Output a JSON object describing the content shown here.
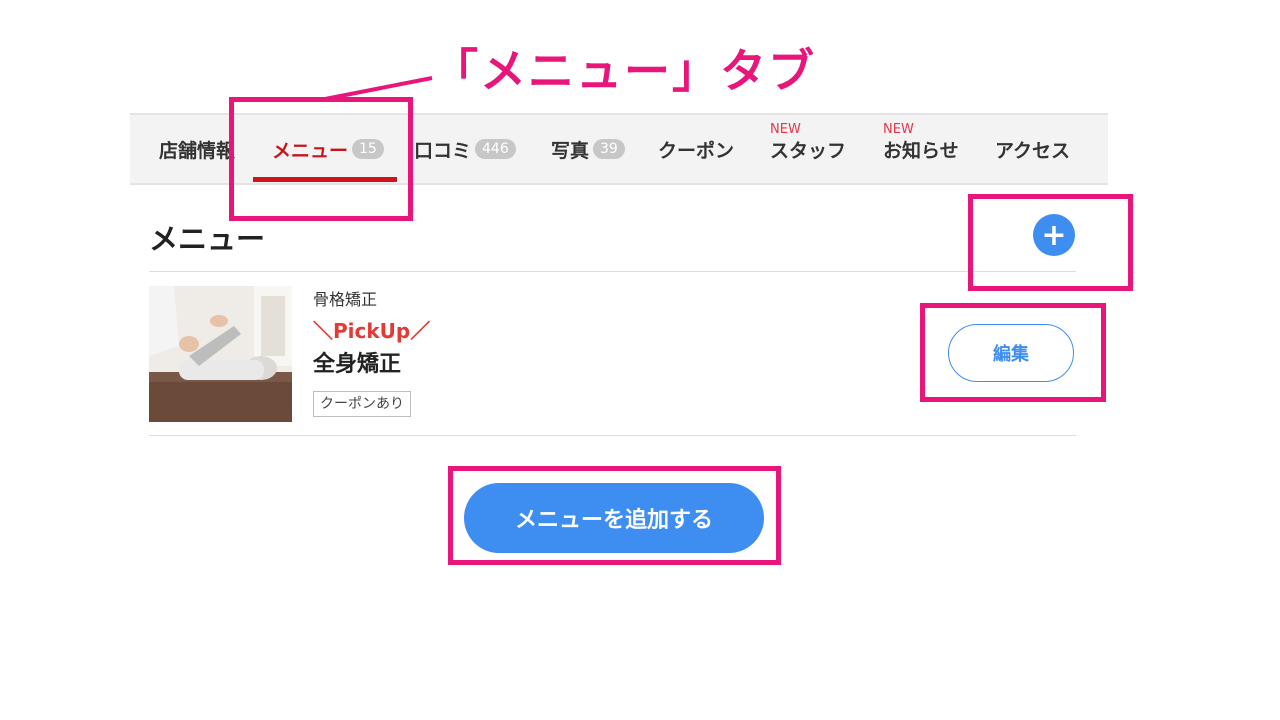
{
  "annotation": {
    "callout_text": "「メニュー」タブ",
    "highlight_color": "#e8157a"
  },
  "tabs": [
    {
      "label": "店舗情報",
      "count": null,
      "new_badge": null,
      "active": false
    },
    {
      "label": "メニュー",
      "count": "15",
      "new_badge": null,
      "active": true
    },
    {
      "label": "口コミ",
      "count": "446",
      "new_badge": null,
      "active": false
    },
    {
      "label": "写真",
      "count": "39",
      "new_badge": null,
      "active": false
    },
    {
      "label": "クーポン",
      "count": null,
      "new_badge": null,
      "active": false
    },
    {
      "label": "スタッフ",
      "count": null,
      "new_badge": "NEW",
      "active": false
    },
    {
      "label": "お知らせ",
      "count": null,
      "new_badge": "NEW",
      "active": false
    },
    {
      "label": "アクセス",
      "count": null,
      "new_badge": null,
      "active": false
    }
  ],
  "section": {
    "title": "メニュー",
    "add_icon": "plus-icon"
  },
  "menu_item": {
    "category": "骨格矯正",
    "pickup_label": "＼PickUp／",
    "name": "全身矯正",
    "tag": "クーポンあり",
    "edit_label": "編集"
  },
  "add_menu_button": {
    "label": "メニューを追加する"
  },
  "colors": {
    "accent": "#3d8ef0",
    "active_tab": "#c4161c",
    "pickup": "#e53935",
    "new_badge": "#e8354a"
  }
}
